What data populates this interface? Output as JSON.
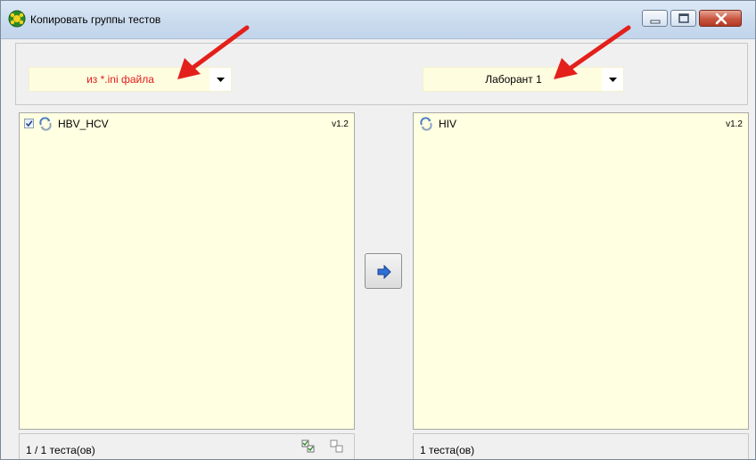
{
  "window": {
    "title": "Копировать группы тестов",
    "controls": [
      "minimize-icon",
      "maximize-icon",
      "close-icon"
    ]
  },
  "source": {
    "selected": "из *.ini файла",
    "items": [
      {
        "checked": true,
        "icon": "group-icon",
        "name": "HBV_HCV",
        "version": "v1.2"
      }
    ],
    "status": "1 / 1 теста(ов)",
    "status_icons": [
      "check-all-icon",
      "uncheck-all-icon"
    ]
  },
  "target": {
    "selected": "Лаборант 1",
    "items": [
      {
        "icon": "group-icon",
        "name": "HIV",
        "version": "v1.2"
      }
    ],
    "status": "1 теста(ов)"
  },
  "move_button": {
    "icon": "arrow-right-icon"
  },
  "colors": {
    "list_background": "#ffffe1",
    "source_combo_text": "#e31b1b",
    "annotation_arrow": "#e3201b",
    "close_button": "#c8553f"
  }
}
